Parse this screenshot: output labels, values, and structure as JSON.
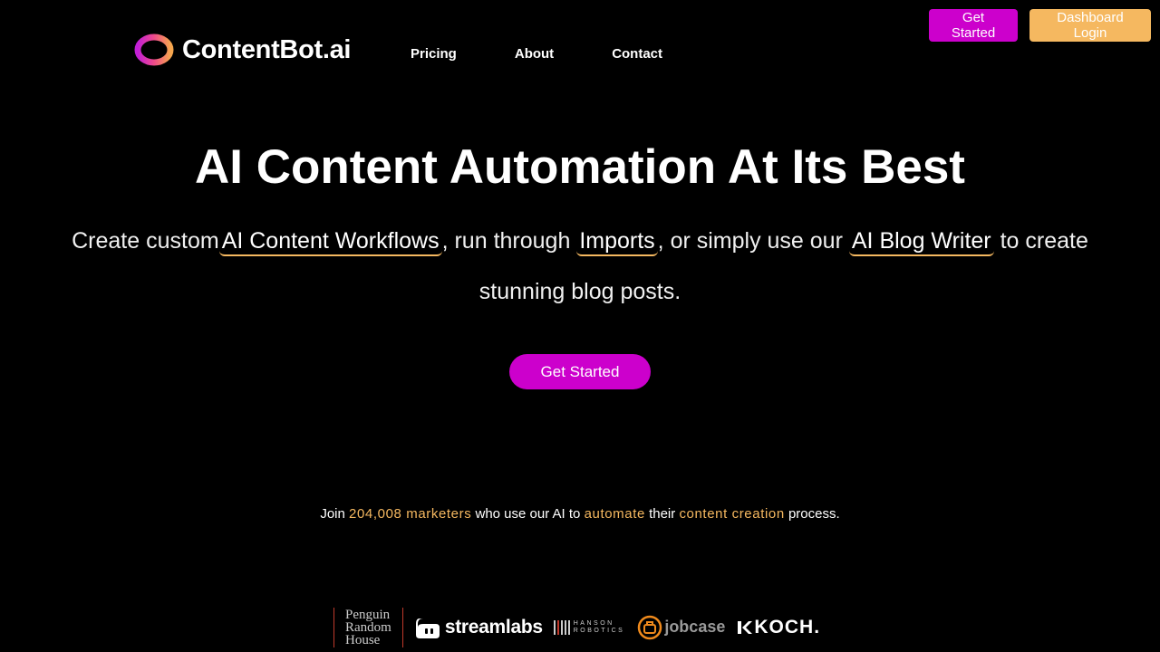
{
  "header": {
    "get_started": "Get Started",
    "dashboard_login": "Dashboard Login",
    "brand": "ContentBot.ai",
    "nav": {
      "pricing": "Pricing",
      "about": "About",
      "contact": "Contact"
    }
  },
  "hero": {
    "title": "AI Content Automation At Its Best",
    "sub_part1": "Create custom",
    "link1": "AI Content Workflows",
    "sub_part2": ", run through",
    "link2": "Imports",
    "sub_part3": ", or simply use our",
    "link3": "AI Blog Writer",
    "sub_part4": "to create stunning blog posts.",
    "cta": "Get Started"
  },
  "stats": {
    "prefix": "Join",
    "count": "204,008 marketers",
    "mid1": "who use our AI to",
    "hl1": "automate",
    "mid2": "their",
    "hl2": "content creation",
    "suffix": "process."
  },
  "logos": {
    "penguin_line1": "Penguin",
    "penguin_line2": "Random",
    "penguin_line3": "House",
    "streamlabs": "streamlabs",
    "hanson_line1": "HANSON",
    "hanson_line2": "ROBOTICS",
    "jobcase": "jobcase",
    "koch": "KOCH."
  },
  "colors": {
    "accent_magenta": "#cc00cc",
    "accent_orange": "#f5b860",
    "background": "#000000"
  }
}
